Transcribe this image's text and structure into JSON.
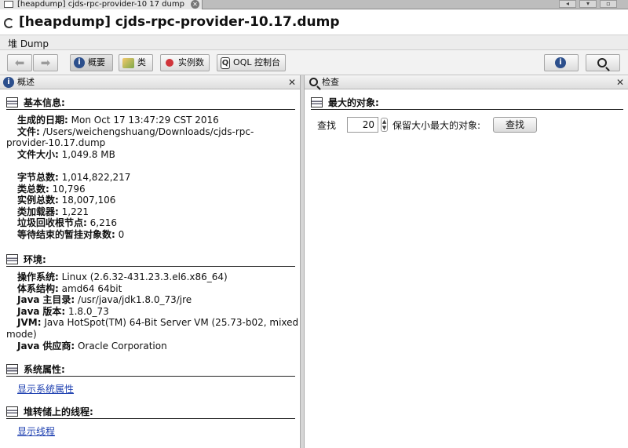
{
  "tab": {
    "label": "[heapdump] cjds-rpc-provider-10 17 dump",
    "close": "✕"
  },
  "window": {
    "title": "[heapdump] cjds-rpc-provider-10.17.dump"
  },
  "menu": {
    "heap_dump": "堆 Dump"
  },
  "toolbar": {
    "back": "back",
    "forward": "forward",
    "summary": "概要",
    "classes": "类",
    "instances": "实例数",
    "oql": "OQL 控制台"
  },
  "overview": {
    "panel_title": "概述",
    "basic": {
      "title": "基本信息:",
      "date_label": "生成的日期:",
      "date_value": "Mon Oct 17 13:47:29 CST 2016",
      "file_label": "文件:",
      "file_value_1": "/Users/weichengshuang/Downloads/cjds-rpc-",
      "file_value_2": "provider-10.17.dump",
      "size_label": "文件大小:",
      "size_value": "1,049.8 MB",
      "bytes_label": "字节总数:",
      "bytes_value": "1,014,822,217",
      "classes_label": "类总数:",
      "classes_value": "10,796",
      "instances_label": "实例总数:",
      "instances_value": "18,007,106",
      "loaders_label": "类加载器:",
      "loaders_value": "1,221",
      "gcroots_label": "垃圾回收根节点:",
      "gcroots_value": "6,216",
      "pending_label": "等待结束的暂挂对象数:",
      "pending_value": "0"
    },
    "env": {
      "title": "环境:",
      "os_label": "操作系统:",
      "os_value": "Linux (2.6.32-431.23.3.el6.x86_64)",
      "arch_label": "体系结构:",
      "arch_value": "amd64 64bit",
      "home_label_1": "Java",
      "home_label_2": "主目录:",
      "home_value": "/usr/java/jdk1.8.0_73/jre",
      "ver_label_1": "Java",
      "ver_label_2": "版本:",
      "ver_value": "1.8.0_73",
      "jvm_label": "JVM:",
      "jvm_value_1": "Java HotSpot(TM) 64-Bit Server VM (25.73-b02, mixed",
      "jvm_value_2": "mode)",
      "vendor_label_1": "Java",
      "vendor_label_2": "供应商:",
      "vendor_value": "Oracle Corporation"
    },
    "sysprops": {
      "title": "系统属性:",
      "link": "显示系统属性"
    },
    "threads": {
      "title": "堆转储上的线程:",
      "link": "显示线程"
    }
  },
  "inspect": {
    "panel_title": "检查",
    "largest_title": "最大的对象:",
    "find_label": "查找",
    "count_value": "20",
    "retain_label": "保留大小最大的对象:",
    "find_button": "查找"
  }
}
